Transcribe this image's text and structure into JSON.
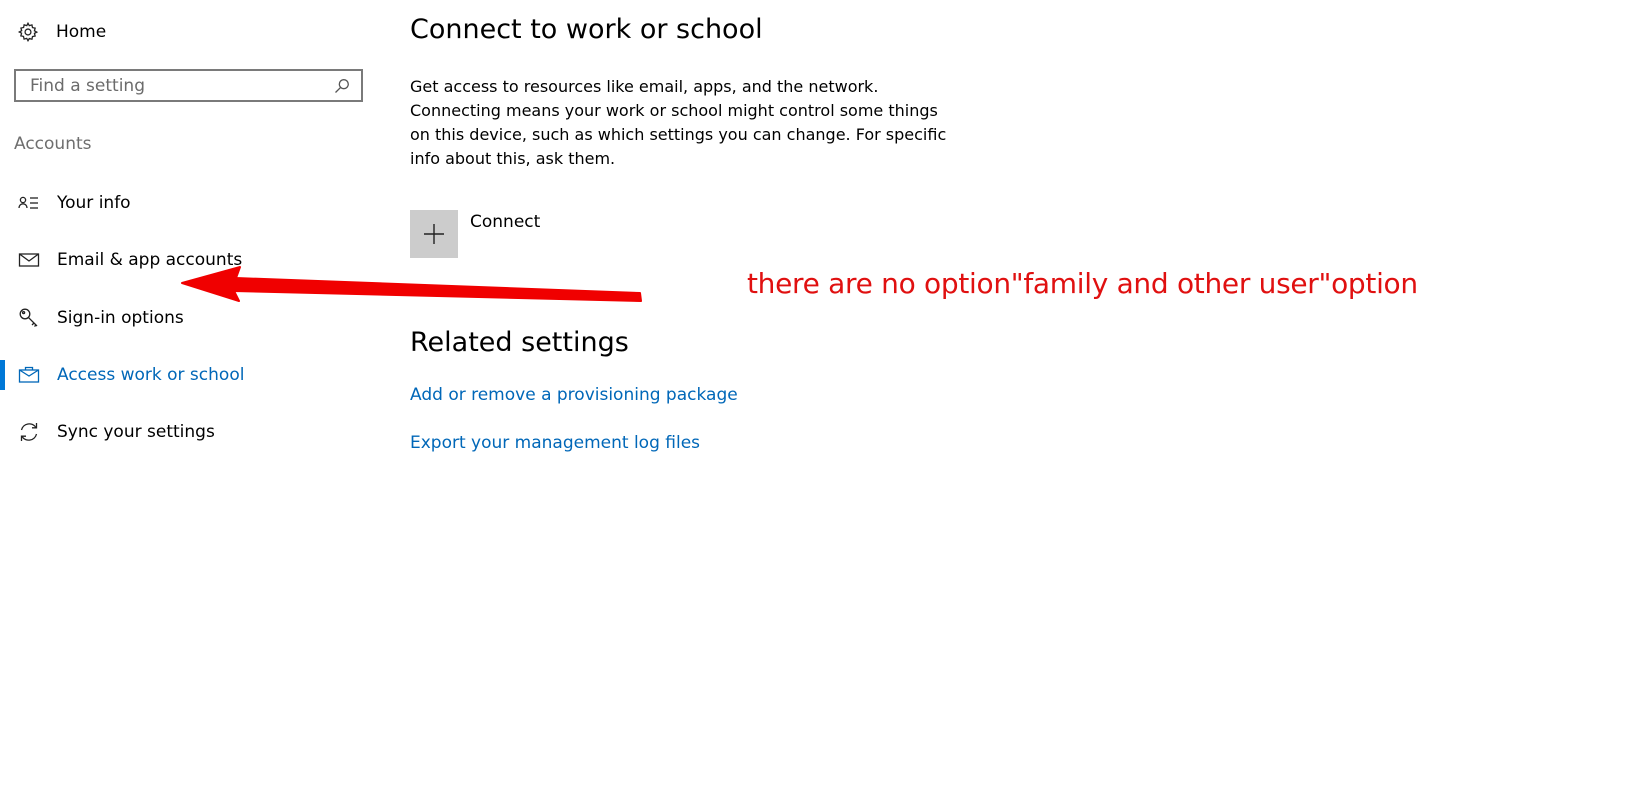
{
  "sidebar": {
    "home_label": "Home",
    "search": {
      "placeholder": "Find a setting",
      "value": ""
    },
    "section_title": "Accounts",
    "items": [
      {
        "label": "Your info",
        "icon": "person-list-icon",
        "selected": false
      },
      {
        "label": "Email & app accounts",
        "icon": "mail-icon",
        "selected": false
      },
      {
        "label": "Sign-in options",
        "icon": "key-icon",
        "selected": false
      },
      {
        "label": "Access work or school",
        "icon": "briefcase-icon",
        "selected": true
      },
      {
        "label": "Sync your settings",
        "icon": "sync-icon",
        "selected": false
      }
    ]
  },
  "main": {
    "title": "Connect to work or school",
    "description": "Get access to resources like email, apps, and the network. Connecting means your work or school might control some things on this device, such as which settings you can change. For specific info about this, ask them.",
    "connect_label": "Connect",
    "related": {
      "title": "Related settings",
      "links": [
        "Add or remove a provisioning package",
        "Export your management log files"
      ]
    }
  },
  "annotation": {
    "text": "there are no option\"family and other user\"option",
    "color": "#e01010"
  },
  "colors": {
    "accent": "#0078d7",
    "link": "#0067b8",
    "tile": "#cccccc"
  }
}
